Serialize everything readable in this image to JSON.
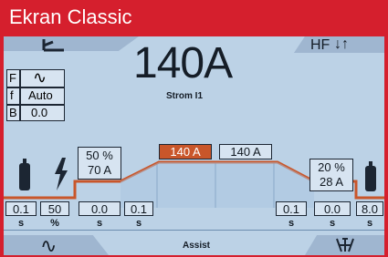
{
  "window": {
    "title": "Ekran Classic"
  },
  "current": {
    "value": "140A",
    "label": "Strom I1"
  },
  "hf": {
    "label": "HF",
    "icon": "up-down-arrows-icon"
  },
  "mode_panel": {
    "rows": [
      {
        "key": "F",
        "value": "∿"
      },
      {
        "key": "f",
        "value": "Auto"
      },
      {
        "key": "B",
        "value": "0.0"
      }
    ]
  },
  "params": {
    "upslope_percent": "50 %",
    "upslope_current": "70 A",
    "main_current_selected": "140 A",
    "main_current": "140 A",
    "end_percent": "20 %",
    "end_current": "28 A"
  },
  "bottom_values": [
    {
      "value": "0.1",
      "unit": "s"
    },
    {
      "value": "50",
      "unit": "%"
    },
    {
      "value": "0.0",
      "unit": "s"
    },
    {
      "value": "0.1",
      "unit": "s"
    },
    {
      "value": "0.1",
      "unit": "s"
    },
    {
      "value": "0.0",
      "unit": "s"
    },
    {
      "value": "8.0",
      "unit": "s"
    }
  ],
  "footer": {
    "assist_label": "Assist",
    "wave_icon": "sine-wave-icon",
    "tool_icon": "torch-icon"
  },
  "colors": {
    "frame": "#d51f2d",
    "screen": "#bcd2e6",
    "curve": "#c9562a",
    "selected": "#c9562a"
  }
}
